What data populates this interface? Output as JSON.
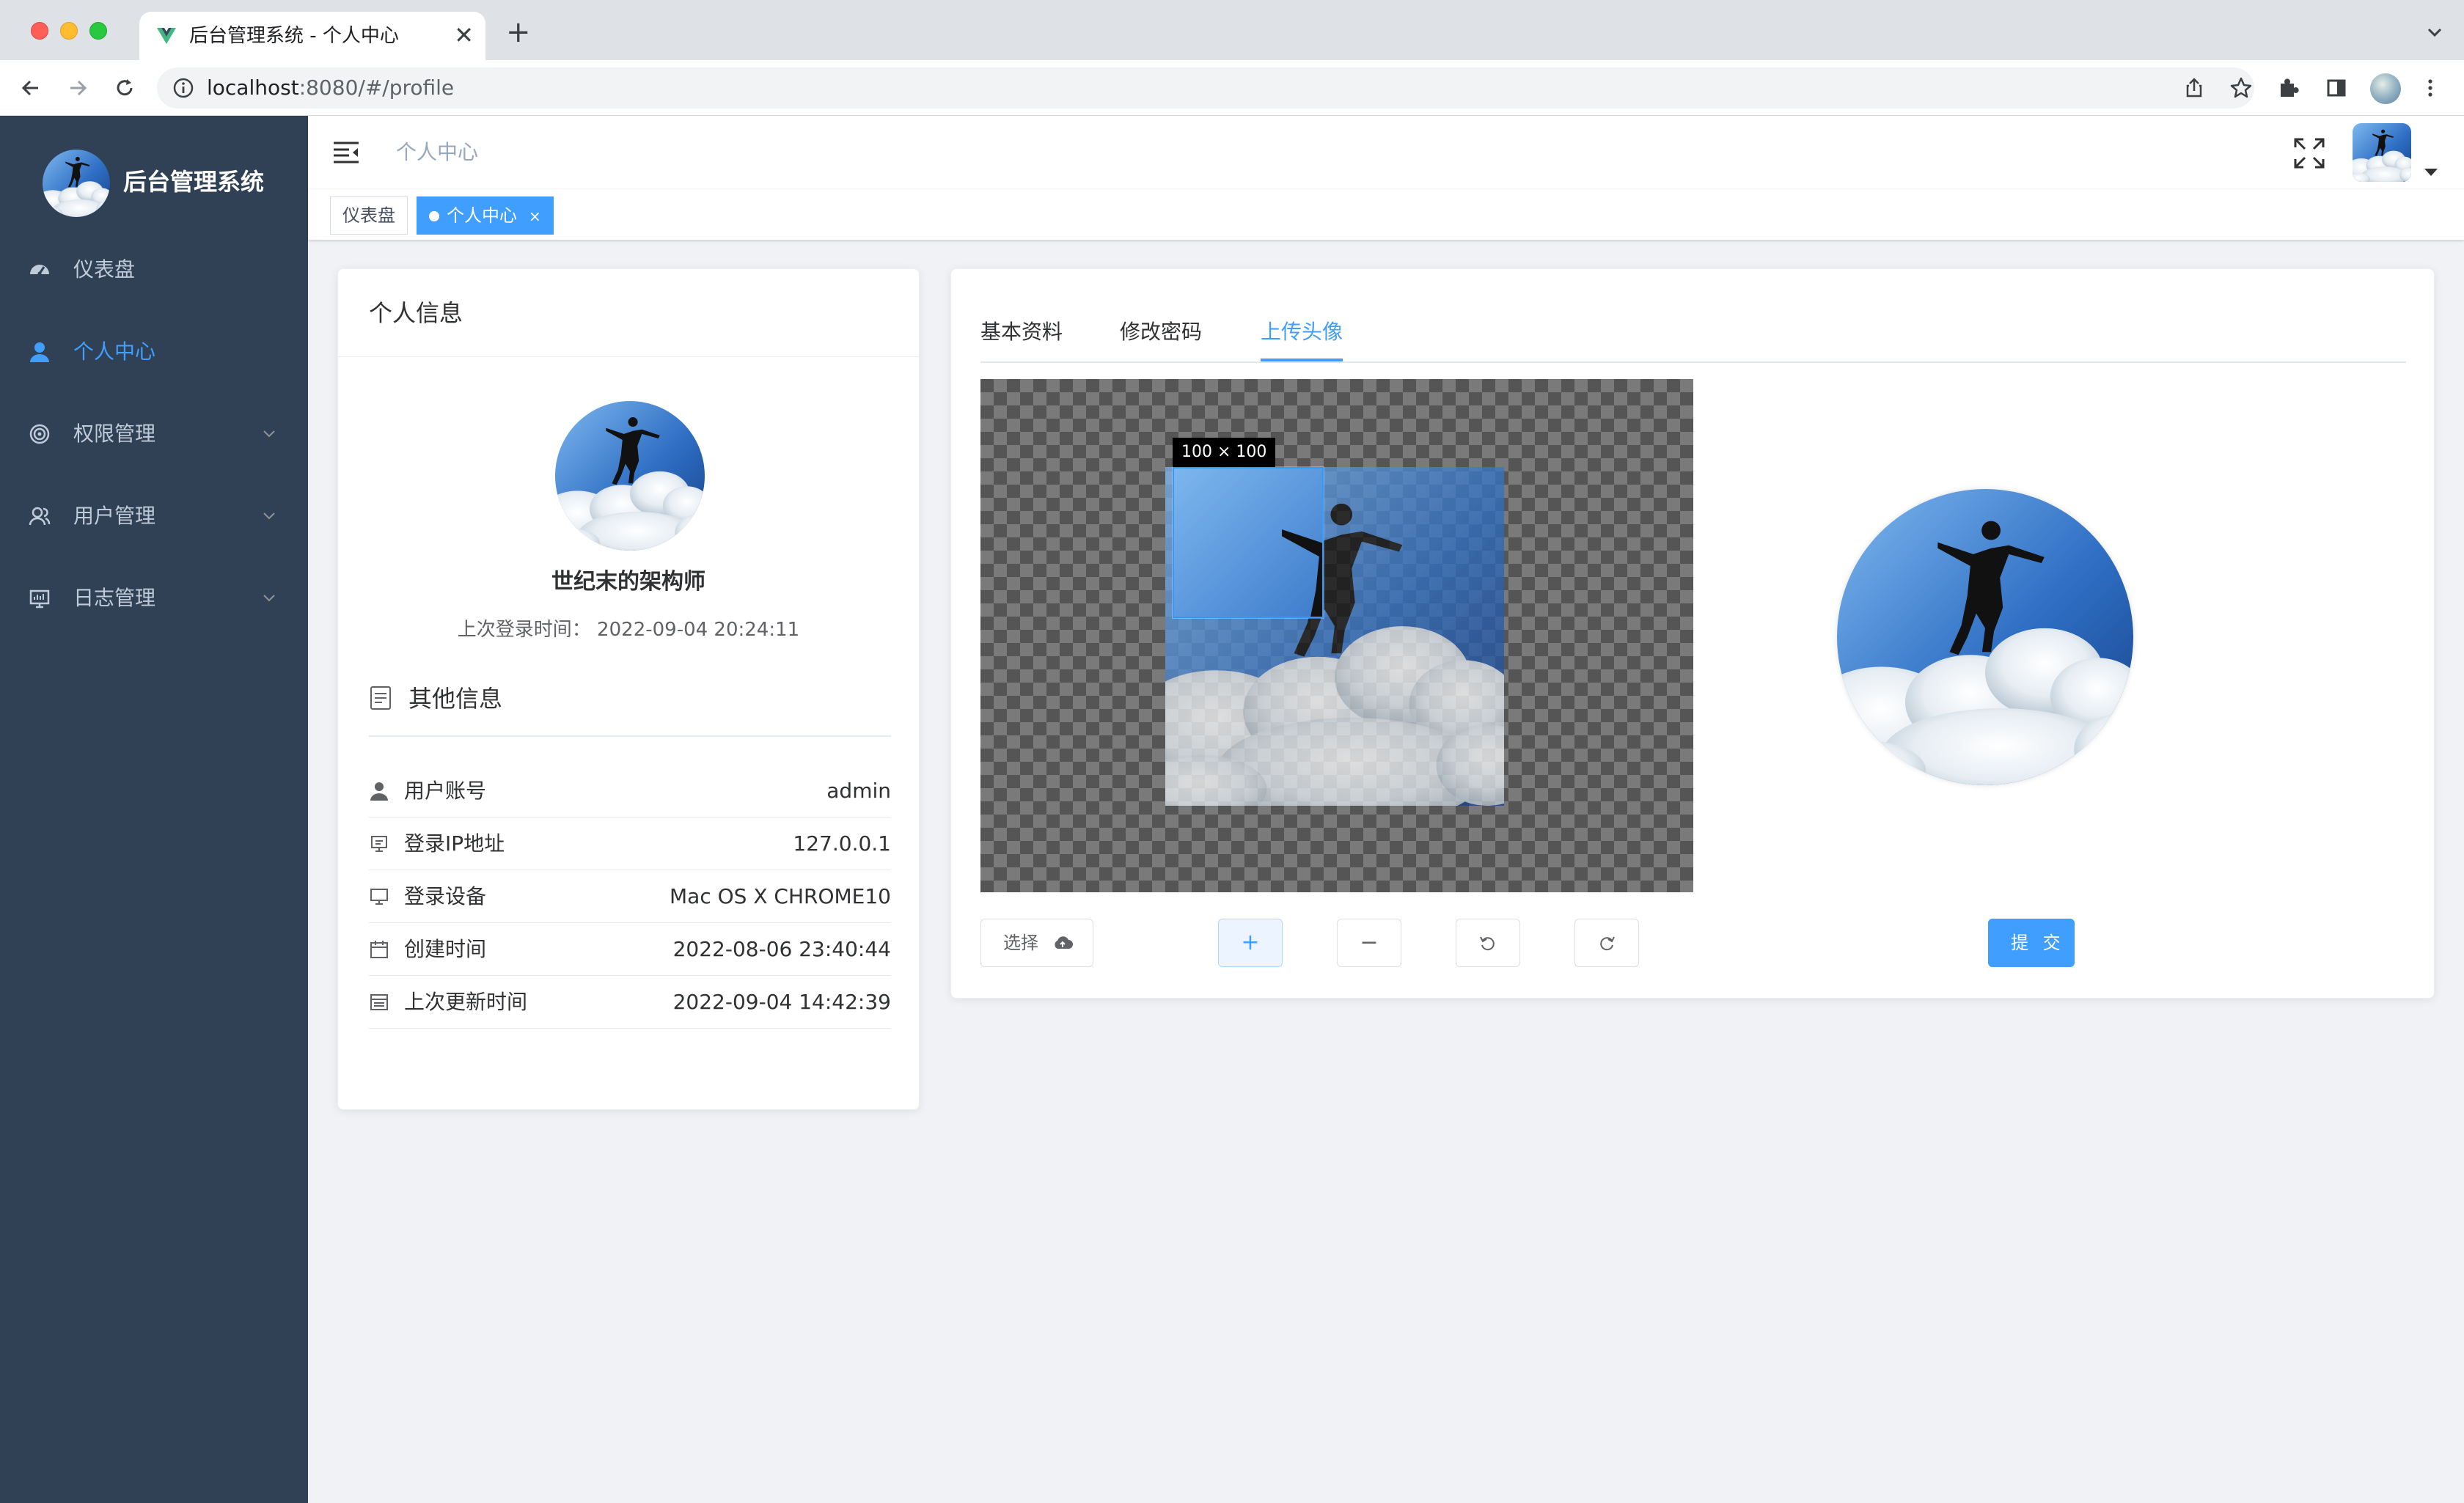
{
  "browser": {
    "tab_title": "后台管理系统 - 个人中心",
    "tab_close": "✕",
    "new_tab": "+",
    "url_host": "localhost",
    "url_rest": ":8080/#/profile"
  },
  "sidebar": {
    "brand": "后台管理系统",
    "items": [
      {
        "label": "仪表盘",
        "icon": "dashboard-icon",
        "active": false
      },
      {
        "label": "个人中心",
        "icon": "user-icon",
        "active": true
      },
      {
        "label": "权限管理",
        "icon": "permission-icon",
        "active": false,
        "expandable": true
      },
      {
        "label": "用户管理",
        "icon": "peoples-icon",
        "active": false,
        "expandable": true
      },
      {
        "label": "日志管理",
        "icon": "log-icon",
        "active": false,
        "expandable": true
      }
    ]
  },
  "header": {
    "breadcrumb": "个人中心"
  },
  "tags": [
    {
      "label": "仪表盘",
      "active": false
    },
    {
      "label": "个人中心",
      "active": true,
      "close": "×"
    }
  ],
  "profile": {
    "card_title": "个人信息",
    "username": "世纪末的架构师",
    "last_login": "上次登录时间： 2022-09-04 20:24:11",
    "other_title": "其他信息",
    "rows": [
      {
        "label": "用户账号",
        "value": "admin",
        "icon": "user-icon"
      },
      {
        "label": "登录IP地址",
        "value": "127.0.0.1",
        "icon": "ip-icon"
      },
      {
        "label": "登录设备",
        "value": "Mac OS X CHROME10",
        "icon": "monitor-icon"
      },
      {
        "label": "创建时间",
        "value": "2022-08-06 23:40:44",
        "icon": "calendar-icon"
      },
      {
        "label": "上次更新时间",
        "value": "2022-09-04 14:42:39",
        "icon": "update-time-icon"
      }
    ]
  },
  "tabs": [
    {
      "label": "基本资料",
      "active": false
    },
    {
      "label": "修改密码",
      "active": false
    },
    {
      "label": "上传头像",
      "active": true
    }
  ],
  "cropper": {
    "size_label": "100 × 100"
  },
  "buttons": {
    "select": "选择",
    "zoom_in": "+",
    "zoom_out": "−",
    "submit": "提 交"
  },
  "colors": {
    "primary": "#409eff",
    "sidebar_bg": "#304156",
    "sidebar_text": "#bfcbd9"
  }
}
